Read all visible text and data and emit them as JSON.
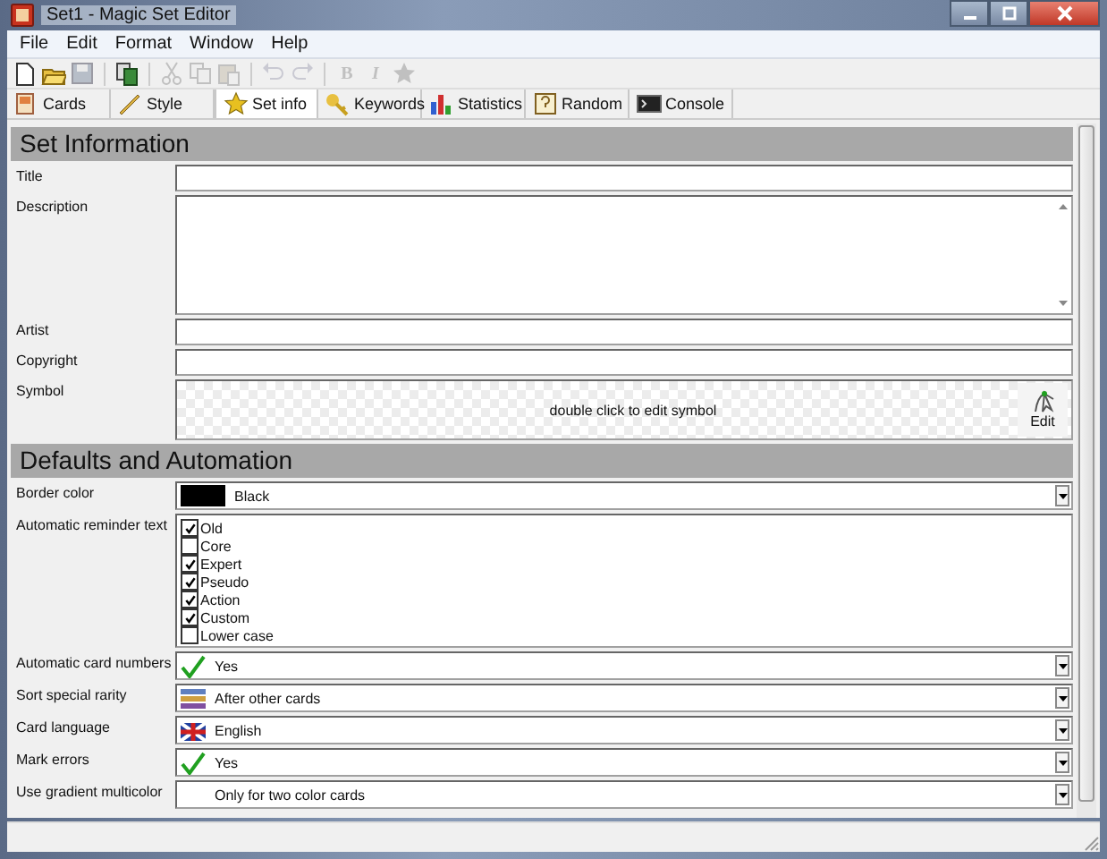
{
  "window": {
    "title": "Set1 - Magic Set Editor"
  },
  "menu": [
    "File",
    "Edit",
    "Format",
    "Window",
    "Help"
  ],
  "toolbar": [
    [
      {
        "disabled": false
      },
      {
        "disabled": false
      },
      {
        "disabled": true
      }
    ],
    [
      {
        "disabled": false
      }
    ],
    [
      {
        "disabled": true
      },
      {
        "disabled": true
      },
      {
        "disabled": true
      }
    ],
    [
      {
        "disabled": true
      },
      {
        "disabled": true
      }
    ],
    [
      {
        "label": "B",
        "disabled": true
      },
      {
        "label": "I",
        "disabled": true
      },
      {
        "disabled": true
      }
    ]
  ],
  "tabs": [
    {
      "label": "Cards",
      "selected": false
    },
    {
      "label": "Style",
      "selected": false
    },
    {
      "label": "Set info",
      "selected": true
    },
    {
      "label": "Keywords",
      "selected": false
    },
    {
      "label": "Statistics",
      "selected": false
    },
    {
      "label": "Random",
      "selected": false
    },
    {
      "label": "Console",
      "selected": false
    }
  ],
  "sections": [
    {
      "title": "Set Information",
      "fields": [
        {
          "kind": "text",
          "label": "Title"
        },
        {
          "kind": "multiline",
          "label": "Description"
        },
        {
          "kind": "text",
          "label": "Artist"
        },
        {
          "kind": "text",
          "label": "Copyright"
        },
        {
          "kind": "symbol",
          "label": "Symbol",
          "hint": "double click to edit symbol",
          "button": "Edit"
        }
      ]
    },
    {
      "title": "Defaults and Automation",
      "fields": [
        {
          "kind": "color",
          "label": "Border color",
          "color": "#000000",
          "value": "Black"
        },
        {
          "kind": "checklist",
          "label": "Automatic reminder text",
          "options": [
            {
              "label": "Old",
              "checked": true
            },
            {
              "label": "Core",
              "checked": false
            },
            {
              "label": "Expert",
              "checked": true
            },
            {
              "label": "Pseudo",
              "checked": true
            },
            {
              "label": "Action",
              "checked": true
            },
            {
              "label": "Custom",
              "checked": true
            },
            {
              "label": "Lower case",
              "checked": false
            }
          ]
        },
        {
          "kind": "choice",
          "label": "Automatic card numbers",
          "value": "Yes"
        },
        {
          "kind": "choice",
          "label": "Sort special rarity",
          "value": "After other cards"
        },
        {
          "kind": "choice",
          "label": "Card language",
          "value": "English"
        },
        {
          "kind": "choice",
          "label": "Mark errors",
          "value": "Yes"
        },
        {
          "kind": "choice",
          "label": "Use gradient multicolor",
          "value": "Only for two color cards"
        }
      ]
    }
  ]
}
